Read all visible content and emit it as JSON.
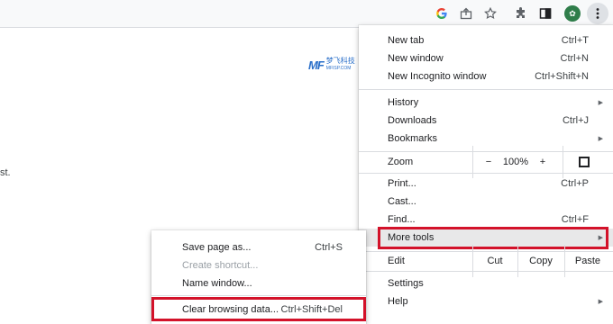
{
  "toolbar": {
    "google_icon": "google-g-icon",
    "share_icon": "share-icon",
    "bookmark_icon": "star-icon",
    "extensions_icon": "puzzle-icon",
    "sidepanel_icon": "side-panel-icon",
    "profile_icon": "avatar",
    "menu_icon": "kebab-menu-icon"
  },
  "watermark": {
    "logo": "MF",
    "text": "梦飞科技",
    "site": "MFISP.COM"
  },
  "page_text": "st.",
  "menu": {
    "new_tab": {
      "label": "New tab",
      "shortcut": "Ctrl+T"
    },
    "new_window": {
      "label": "New window",
      "shortcut": "Ctrl+N"
    },
    "new_incognito": {
      "label": "New Incognito window",
      "shortcut": "Ctrl+Shift+N"
    },
    "history": {
      "label": "History"
    },
    "downloads": {
      "label": "Downloads",
      "shortcut": "Ctrl+J"
    },
    "bookmarks": {
      "label": "Bookmarks"
    },
    "zoom": {
      "label": "Zoom",
      "minus": "−",
      "value": "100%",
      "plus": "+"
    },
    "print": {
      "label": "Print...",
      "shortcut": "Ctrl+P"
    },
    "cast": {
      "label": "Cast..."
    },
    "find": {
      "label": "Find...",
      "shortcut": "Ctrl+F"
    },
    "more_tools": {
      "label": "More tools"
    },
    "edit": {
      "label": "Edit",
      "cut": "Cut",
      "copy": "Copy",
      "paste": "Paste"
    },
    "settings": {
      "label": "Settings"
    },
    "help": {
      "label": "Help"
    }
  },
  "submenu": {
    "save_page": {
      "label": "Save page as...",
      "shortcut": "Ctrl+S"
    },
    "create_shortcut": {
      "label": "Create shortcut..."
    },
    "name_window": {
      "label": "Name window..."
    },
    "clear_browsing": {
      "label": "Clear browsing data...",
      "shortcut": "Ctrl+Shift+Del"
    }
  },
  "colors": {
    "highlight_border": "#d3122a",
    "accent": "#1a73e8"
  }
}
